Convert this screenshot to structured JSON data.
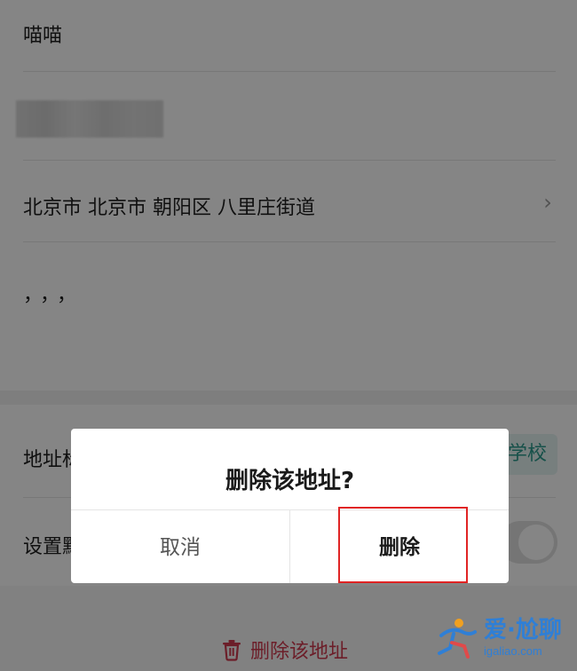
{
  "form": {
    "name_value": "喵喵",
    "region_value": "北京市 北京市 朝阳区 八里庄街道",
    "detail_value": "，，，",
    "tag_label_partial": "地址标",
    "tag_chip_partial": "学校",
    "default_label_partial": "设置默"
  },
  "bottom": {
    "delete_address_label": "删除该地址"
  },
  "dialog": {
    "title": "删除该地址?",
    "cancel_label": "取消",
    "confirm_label": "删除"
  },
  "watermark": {
    "main_text": "爱·尬聊",
    "sub_text": "igaliao.com"
  },
  "colors": {
    "accent_red": "#d03a4f",
    "highlight_red": "#e02424",
    "teal": "#2b9a8c"
  }
}
